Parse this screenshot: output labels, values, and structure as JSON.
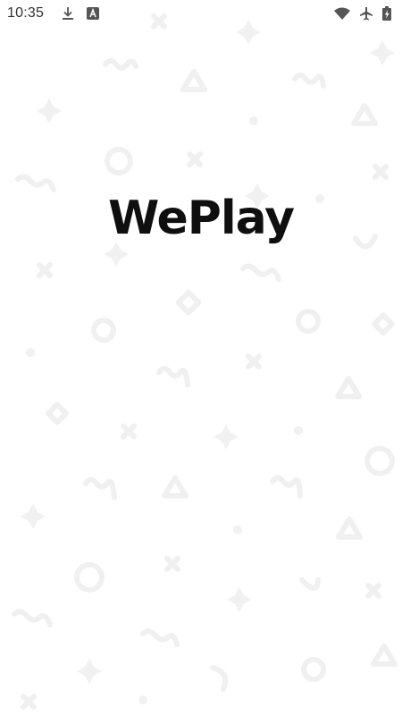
{
  "status_bar": {
    "time": "10:35",
    "left_icons": [
      "download-icon",
      "app-notification-icon"
    ],
    "right_icons": [
      "wifi-icon",
      "airplane-mode-icon",
      "battery-charging-icon"
    ]
  },
  "splash": {
    "logo_text": "WePlay"
  },
  "colors": {
    "background": "#ffffff",
    "logo": "#0f0f0f",
    "pattern": "#f1f1f1",
    "status_text": "#333333"
  }
}
